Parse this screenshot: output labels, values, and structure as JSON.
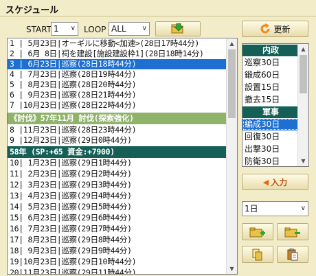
{
  "title": "スケジュール",
  "controls": {
    "start_label": "START",
    "start_value": "1",
    "loop_label": "LOOP",
    "loop_value": "ALL",
    "refresh_label": "更新"
  },
  "schedule_rows": [
    {
      "text": "1 | 5月23日|オーギルに移動<加速>(28日17時44分)",
      "style": "normal"
    },
    {
      "text": "2 | 6月 8日|祠を建設[施設建設枠1](28日18時14分)",
      "style": "normal"
    },
    {
      "text": "3 | 6月23日|巡察(28日18時44分)",
      "style": "selected"
    },
    {
      "text": "4 | 7月23日|巡察(28日19時44分)",
      "style": "normal"
    },
    {
      "text": "5 | 8月23日|巡察(28日20時44分)",
      "style": "normal"
    },
    {
      "text": "6 | 9月23日|巡察(28日21時44分)",
      "style": "normal"
    },
    {
      "text": "7 |10月23日|巡察(28日22時44分)",
      "style": "normal"
    },
    {
      "text": "《討伐》57年11月 討伐(探索強化)",
      "style": "event"
    },
    {
      "text": "8 |11月23日|巡察(28日23時44分)",
      "style": "normal"
    },
    {
      "text": "9 |12月23日|巡察(29日0時44分)",
      "style": "normal"
    },
    {
      "text": "  58年 (SP:+65 資金:+7900)",
      "style": "year"
    },
    {
      "text": "10| 1月23日|巡察(29日1時44分)",
      "style": "normal"
    },
    {
      "text": "11| 2月23日|巡察(29日2時44分)",
      "style": "normal"
    },
    {
      "text": "12| 3月23日|巡察(29日3時44分)",
      "style": "normal"
    },
    {
      "text": "13| 4月23日|巡察(29日4時44分)",
      "style": "normal"
    },
    {
      "text": "14| 5月23日|巡察(29日5時44分)",
      "style": "normal"
    },
    {
      "text": "15| 6月23日|巡察(29日6時44分)",
      "style": "normal"
    },
    {
      "text": "16| 7月23日|巡察(29日7時44分)",
      "style": "normal"
    },
    {
      "text": "17| 8月23日|巡察(29日8時44分)",
      "style": "normal"
    },
    {
      "text": "18| 9月23日|巡察(29日9時44分)",
      "style": "normal"
    },
    {
      "text": "19|10月23日|巡察(29日10時44分)",
      "style": "normal"
    },
    {
      "text": "20|11月23日|巡察(29日11時44分)",
      "style": "normal"
    }
  ],
  "commands": [
    {
      "text": "内政",
      "style": "header"
    },
    {
      "text": "巡察30日",
      "style": "normal"
    },
    {
      "text": "鍛成60日",
      "style": "normal"
    },
    {
      "text": "設置15日",
      "style": "normal"
    },
    {
      "text": "撤去15日",
      "style": "normal"
    },
    {
      "text": "軍事",
      "style": "header"
    },
    {
      "text": "編成30日",
      "style": "active"
    },
    {
      "text": "回復30日",
      "style": "normal"
    },
    {
      "text": "出撃30日",
      "style": "normal"
    },
    {
      "text": "防衛30日",
      "style": "normal"
    }
  ],
  "input_label": "入力",
  "duration_value": "1日",
  "colors": {
    "background": "#f3ecc9",
    "selected": "#1d6fd1",
    "event": "#8fb36a",
    "year_header": "#155f57",
    "refresh_icon": "#f08a1a"
  }
}
